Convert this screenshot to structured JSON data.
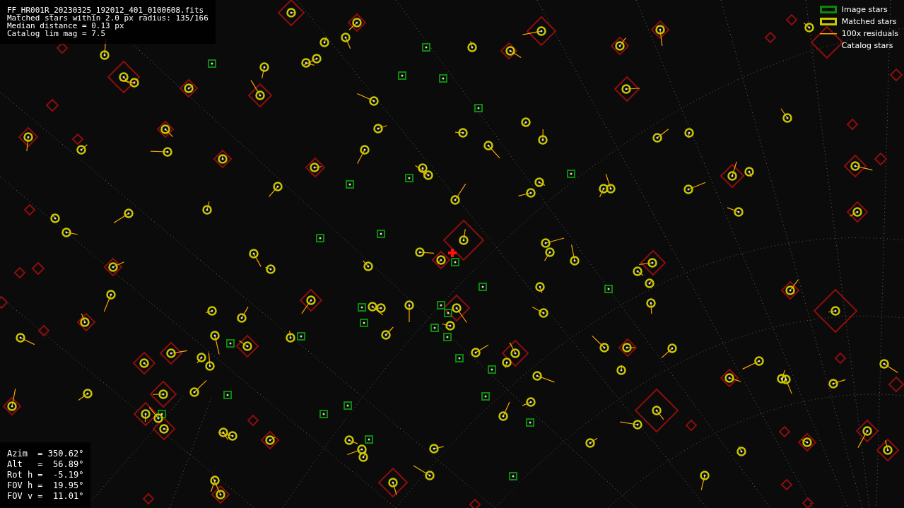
{
  "file_info": {
    "lines": [
      "FF_HR001R_20230325_192012_401_0100608.fits",
      "Matched stars within 2.0 px radius: 135/166",
      "Median distance = 0.13 px",
      "Catalog lim mag = 7.5"
    ]
  },
  "legend": {
    "items": [
      {
        "kind": "image",
        "label": "Image stars"
      },
      {
        "kind": "matched",
        "label": "Matched stars"
      },
      {
        "kind": "residual",
        "label": "100x residuals"
      },
      {
        "kind": "catalog",
        "label": "Catalog stars"
      }
    ]
  },
  "pointing": {
    "lines": [
      "Azim  = 350.62°",
      "Alt   =  56.89°",
      "Rot h =  -5.19°",
      "FOV h =  19.95°",
      "FOV v =  11.01°"
    ]
  }
}
